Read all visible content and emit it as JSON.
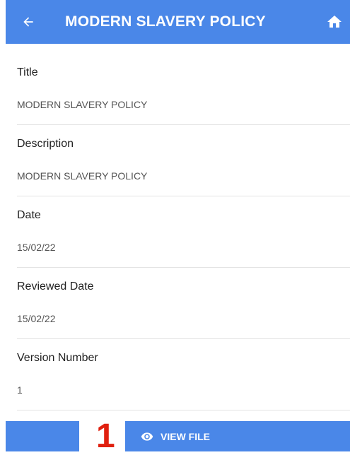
{
  "header": {
    "title": "MODERN SLAVERY POLICY",
    "back_icon": "arrow-left-icon",
    "home_icon": "home-icon",
    "background": "#4a87e8"
  },
  "fields": [
    {
      "label": "Title",
      "value": "MODERN SLAVERY POLICY"
    },
    {
      "label": "Description",
      "value": "MODERN SLAVERY POLICY"
    },
    {
      "label": "Date",
      "value": "15/02/22"
    },
    {
      "label": "Reviewed Date",
      "value": "15/02/22"
    },
    {
      "label": "Version Number",
      "value": "1"
    }
  ],
  "footer": {
    "page_number": "1",
    "page_number_color": "#e0200f",
    "view_file_label": "VIEW FILE",
    "view_file_icon": "eye-icon"
  }
}
